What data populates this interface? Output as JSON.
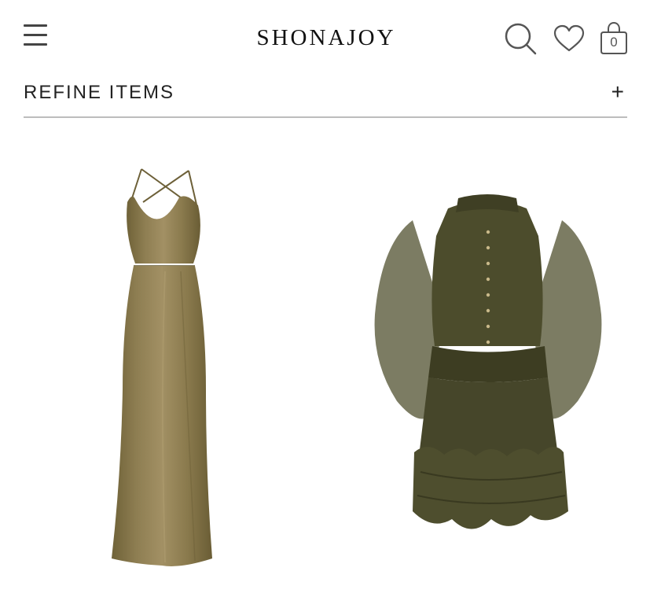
{
  "header": {
    "brand": "SHONAJOY",
    "menu_icon": "hamburger-menu-icon",
    "search_icon": "search-icon",
    "wishlist_icon": "heart-icon",
    "bag_icon": "shopping-bag-icon",
    "bag_count": "0"
  },
  "refine": {
    "label": "REFINE ITEMS",
    "expand_symbol": "+"
  },
  "products": [
    {
      "image": "olive-satin-cowl-neck-maxi-dress",
      "color": "#8a7a4f"
    },
    {
      "image": "dark-olive-sheer-ruffle-mini-dress",
      "color": "#4a4a30"
    }
  ]
}
